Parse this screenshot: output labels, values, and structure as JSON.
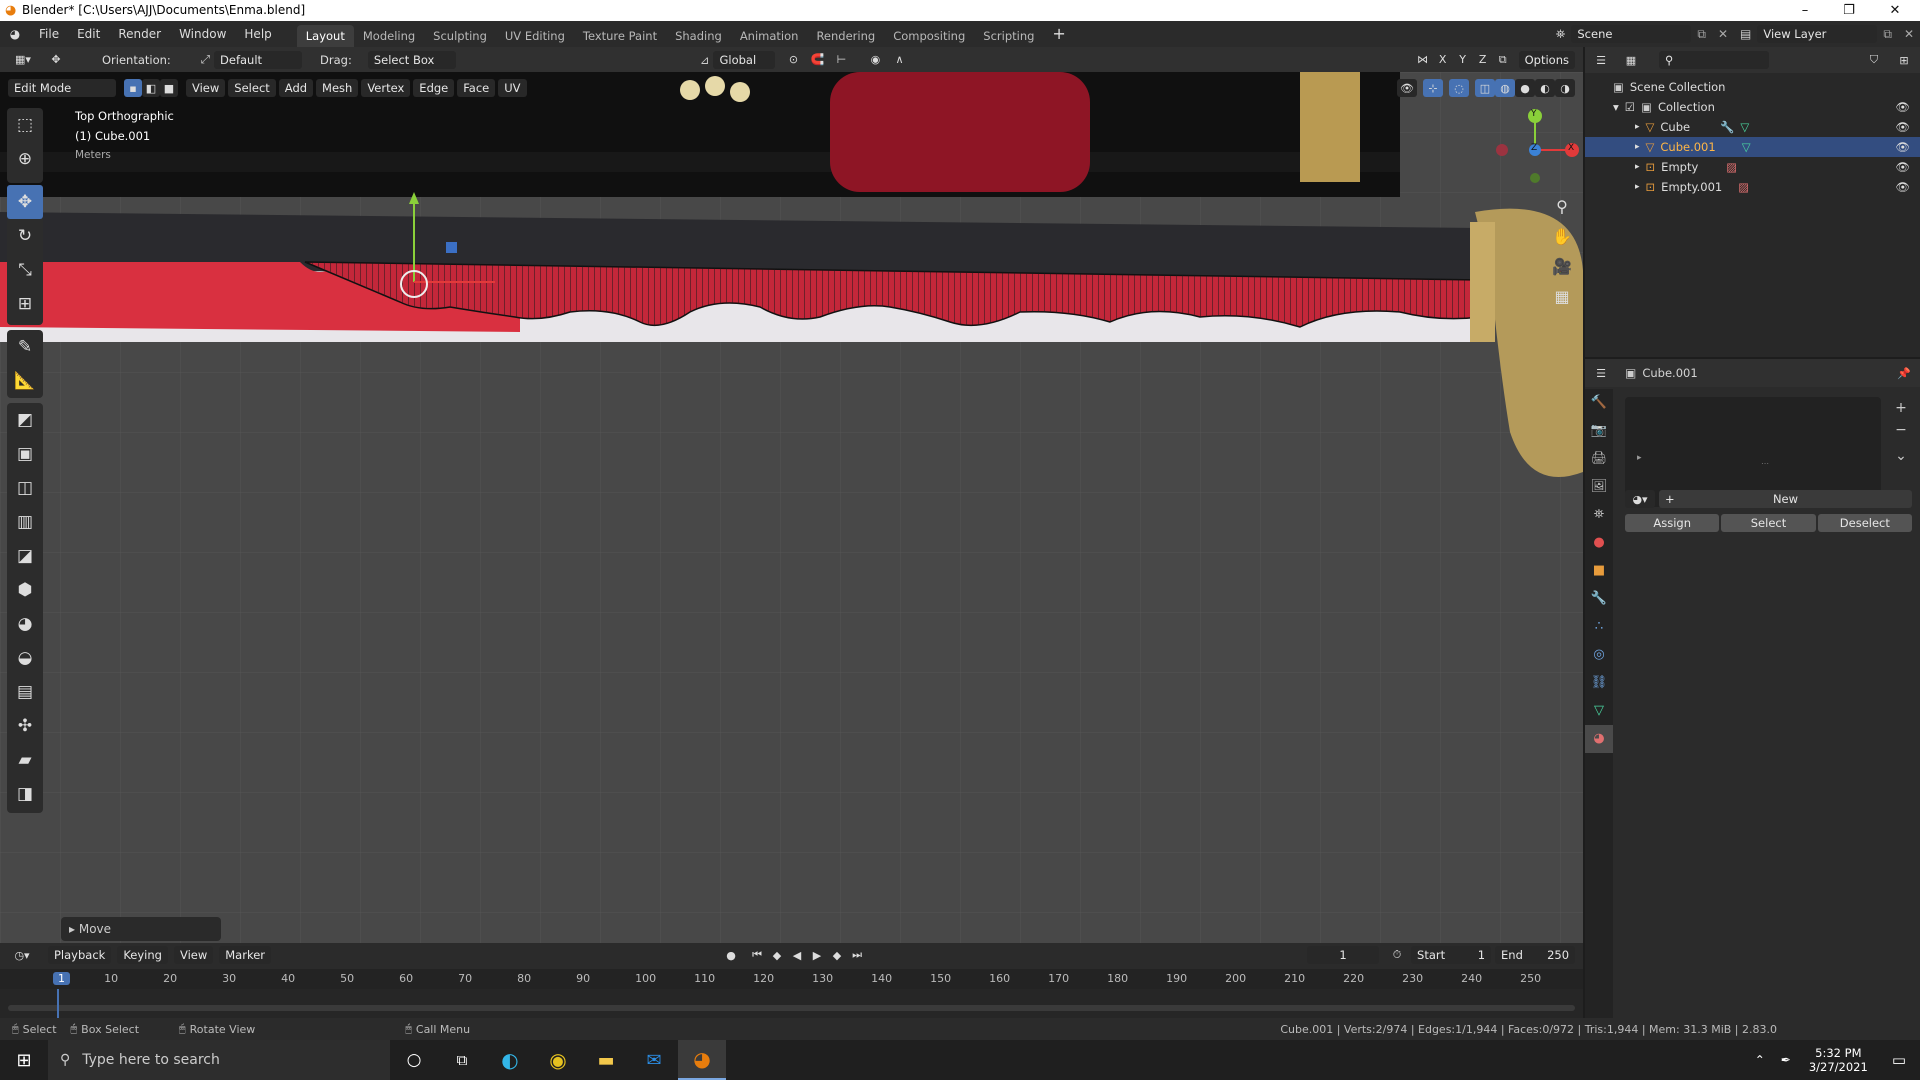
{
  "window": {
    "title": "Blender* [C:\\Users\\AJJ\\Documents\\Enma.blend]"
  },
  "menu": [
    "File",
    "Edit",
    "Render",
    "Window",
    "Help"
  ],
  "workspaces": [
    "Layout",
    "Modeling",
    "Sculpting",
    "UV Editing",
    "Texture Paint",
    "Shading",
    "Animation",
    "Rendering",
    "Compositing",
    "Scripting"
  ],
  "active_workspace": "Layout",
  "scene": "Scene",
  "view_layer": "View Layer",
  "toolsettings": {
    "orientation_label": "Orientation:",
    "orientation_value": "Default",
    "drag_label": "Drag:",
    "drag_value": "Select Box",
    "transform_orientation": "Global",
    "options": "Options",
    "axes": [
      "X",
      "Y",
      "Z"
    ]
  },
  "editheader": {
    "mode": "Edit Mode",
    "menus": [
      "View",
      "Select",
      "Add",
      "Mesh",
      "Vertex",
      "Edge",
      "Face",
      "UV"
    ]
  },
  "viewport": {
    "view_name": "Top Orthographic",
    "object_name": "(1) Cube.001",
    "units": "Meters",
    "last_op": "Move"
  },
  "gizmo": {
    "x": "X",
    "y": "Y",
    "z": "Z"
  },
  "outliner": {
    "root": "Scene Collection",
    "items": [
      {
        "name": "Collection",
        "selected": false
      },
      {
        "name": "Cube",
        "selected": false
      },
      {
        "name": "Cube.001",
        "selected": true
      },
      {
        "name": "Empty",
        "selected": false
      },
      {
        "name": "Empty.001",
        "selected": false
      }
    ]
  },
  "properties": {
    "object": "Cube.001",
    "new": "New",
    "assign": "Assign",
    "select": "Select",
    "deselect": "Deselect"
  },
  "timeline": {
    "menus": [
      "Playback",
      "Keying",
      "View",
      "Marker"
    ],
    "current_frame": "1",
    "start_label": "Start",
    "start": "1",
    "end_label": "End",
    "end": "250",
    "ticks": [
      "1",
      "10",
      "20",
      "30",
      "40",
      "50",
      "60",
      "70",
      "80",
      "90",
      "100",
      "110",
      "120",
      "130",
      "140",
      "150",
      "160",
      "170",
      "180",
      "190",
      "200",
      "210",
      "220",
      "230",
      "240",
      "250"
    ]
  },
  "statusbar": {
    "select": "Select",
    "box_select": "Box Select",
    "rotate": "Rotate View",
    "call_menu": "Call Menu",
    "stats": "Cube.001 | Verts:2/974 | Edges:1/1,944 | Faces:0/972 | Tris:1,944 | Mem: 31.3 MiB | 2.83.0"
  },
  "taskbar": {
    "search_placeholder": "Type here to search",
    "time": "5:32 PM",
    "date": "3/27/2021"
  },
  "colors": {
    "accent": "#4772b3",
    "selected_row": "#334d80",
    "mesh_red": "#c4273a"
  }
}
